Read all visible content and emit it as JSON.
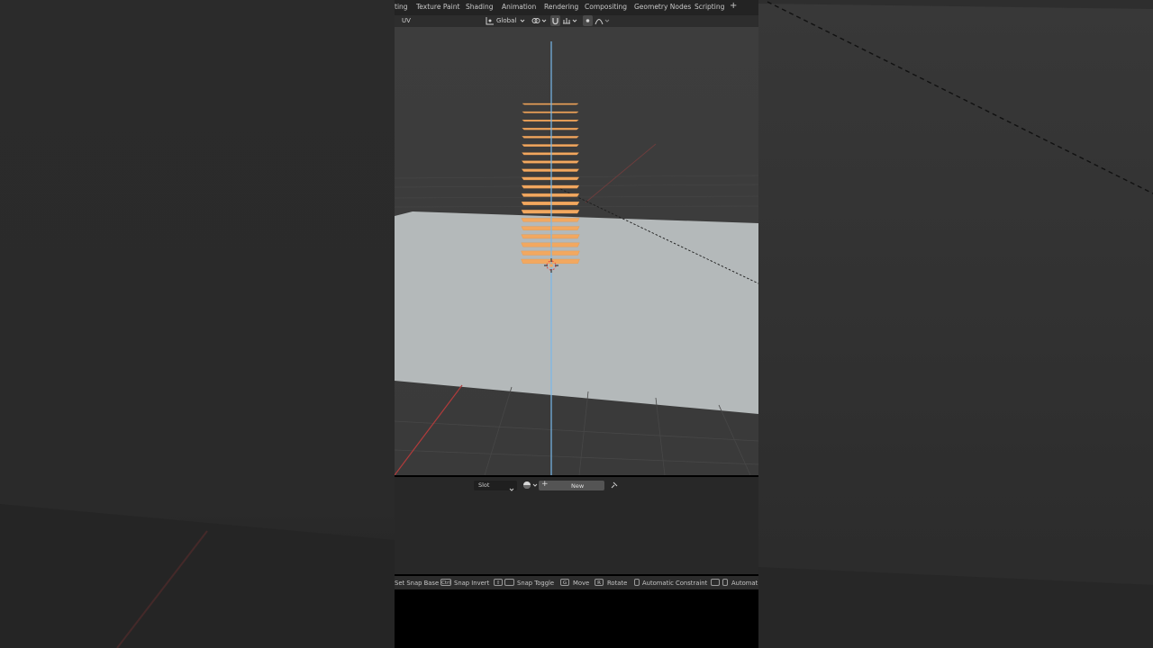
{
  "workspace_tabs": [
    "ting",
    "Texture Paint",
    "Shading",
    "Animation",
    "Rendering",
    "Compositing",
    "Geometry Nodes",
    "Scripting",
    "+"
  ],
  "viewport_header": {
    "mode_label": "UV",
    "orientation": "Global"
  },
  "material_panel": {
    "slot_label": "Slot",
    "new_label": "New"
  },
  "status_bar": {
    "items": [
      {
        "label": "Set Snap Base"
      },
      {
        "key": "Ctrl",
        "label": "Snap Invert"
      },
      {
        "key": "⇧",
        "label": "Snap Toggle"
      },
      {
        "key": "G",
        "label": "Move"
      },
      {
        "key": "R",
        "label": "Rotate"
      },
      {
        "label": "Automatic Constraint"
      },
      {
        "label": "Automat"
      }
    ]
  },
  "colors": {
    "ground_plane": "#b4b9ba",
    "selected_objects": "#f2a860",
    "z_axis": "#78b8ea",
    "x_axis": "#b13b3b"
  },
  "icons": {
    "orientation": "transform-orientation-icon",
    "pivot": "link-icon",
    "snap": "magnet-icon",
    "snap_target": "snap-increment-icon",
    "proportional": "proportional-edit-icon",
    "falloff": "falloff-curve-icon",
    "browse_material": "sphere-icon",
    "add": "plus-icon",
    "pin": "pin-icon"
  }
}
